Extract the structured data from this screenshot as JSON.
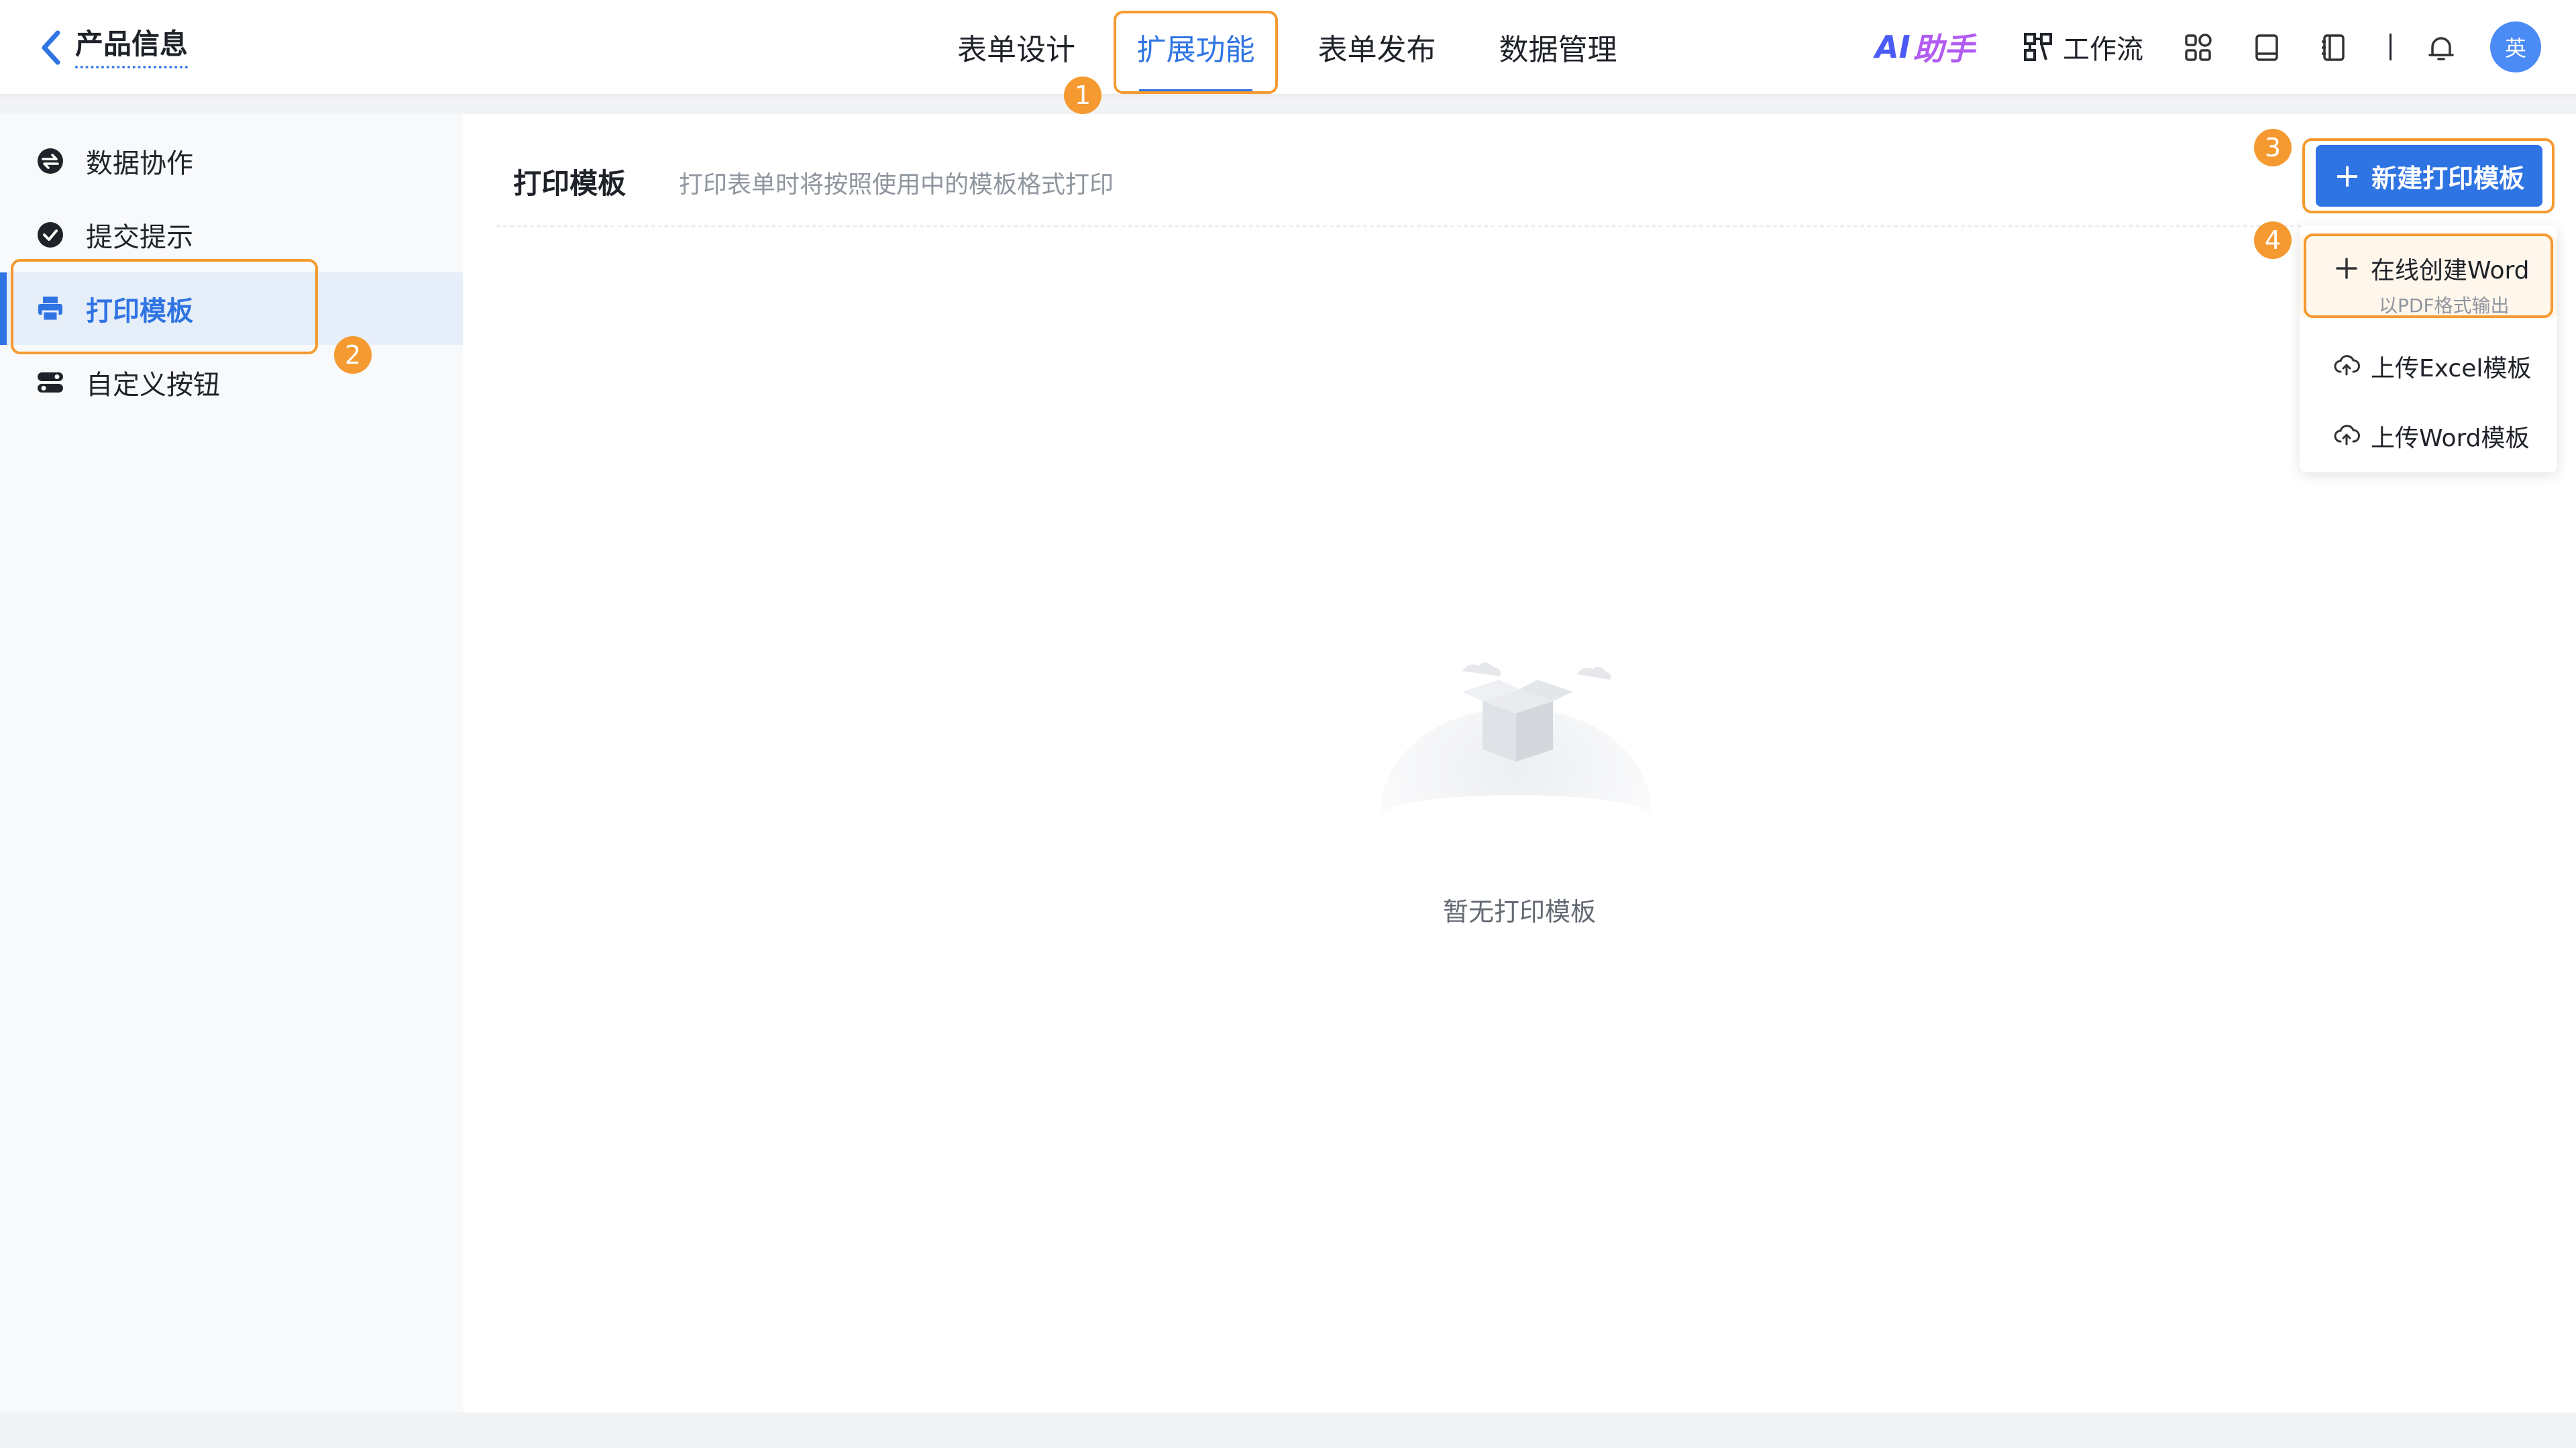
{
  "header": {
    "back_title": "产品信息",
    "tabs": [
      {
        "label": "表单设计",
        "active": false
      },
      {
        "label": "扩展功能",
        "active": true
      },
      {
        "label": "表单发布",
        "active": false
      },
      {
        "label": "数据管理",
        "active": false
      }
    ],
    "ai_label_a": "AI",
    "ai_label_b": "助手",
    "workflow_label": "工作流",
    "avatar_text": "英"
  },
  "sidebar": {
    "items": [
      {
        "label": "数据协作",
        "icon": "data-collab-icon",
        "active": false
      },
      {
        "label": "提交提示",
        "icon": "check-circle-icon",
        "active": false
      },
      {
        "label": "打印模板",
        "icon": "printer-icon",
        "active": true
      },
      {
        "label": "自定义按钮",
        "icon": "toggle-icon",
        "active": false
      }
    ]
  },
  "main": {
    "title": "打印模板",
    "description": "打印表单时将按照使用中的模板格式打印",
    "new_button_plus": "+",
    "new_button_label": "新建打印模板",
    "dropdown": [
      {
        "label": "在线创建Word",
        "sub": "以PDF格式输出",
        "icon": "plus-icon"
      },
      {
        "label": "上传Excel模板",
        "icon": "cloud-upload-icon"
      },
      {
        "label": "上传Word模板",
        "icon": "cloud-upload-icon"
      }
    ],
    "empty_text": "暂无打印模板"
  },
  "annotations": {
    "badges": [
      "1",
      "2",
      "3",
      "4"
    ]
  },
  "colors": {
    "accent": "#2f74e3",
    "highlight": "#f59a30",
    "sidebar_active_bg": "#e6eef9"
  }
}
